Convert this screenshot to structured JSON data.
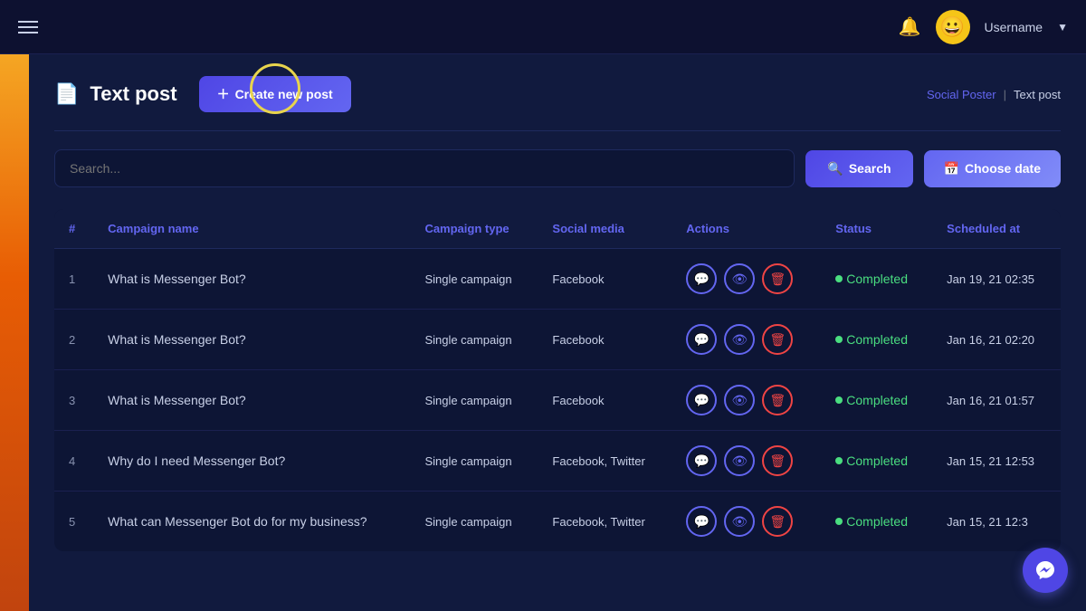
{
  "navbar": {
    "hamburger_label": "menu",
    "bell_label": "notifications",
    "user_emoji": "😀",
    "user_name": "Username",
    "dropdown_label": "▼"
  },
  "page": {
    "icon": "📄",
    "title": "Text post",
    "create_btn_label": "Create new post",
    "create_btn_icon": "＋",
    "breadcrumb": {
      "parent": "Social Poster",
      "separator": "|",
      "current": "Text post"
    }
  },
  "search": {
    "placeholder": "Search...",
    "search_label": "Search",
    "search_icon": "🔍",
    "choose_date_label": "Choose date",
    "calendar_icon": "📅"
  },
  "table": {
    "columns": [
      "#",
      "Campaign name",
      "Campaign type",
      "Social media",
      "Actions",
      "Status",
      "Scheduled at"
    ],
    "rows": [
      {
        "num": "1",
        "name": "What is Messenger Bot?",
        "type": "Single campaign",
        "social": "Facebook",
        "status": "Completed",
        "scheduled": "Jan 19, 21 02:35"
      },
      {
        "num": "2",
        "name": "What is Messenger Bot?",
        "type": "Single campaign",
        "social": "Facebook",
        "status": "Completed",
        "scheduled": "Jan 16, 21 02:20"
      },
      {
        "num": "3",
        "name": "What is Messenger Bot?",
        "type": "Single campaign",
        "social": "Facebook",
        "status": "Completed",
        "scheduled": "Jan 16, 21 01:57"
      },
      {
        "num": "4",
        "name": "Why do I need Messenger Bot?",
        "type": "Single campaign",
        "social": "Facebook, Twitter",
        "status": "Completed",
        "scheduled": "Jan 15, 21 12:53"
      },
      {
        "num": "5",
        "name": "What can Messenger Bot do for my business?",
        "type": "Single campaign",
        "social": "Facebook, Twitter",
        "status": "Completed",
        "scheduled": "Jan 15, 21 12:3"
      }
    ]
  },
  "messenger_fab_icon": "💬"
}
